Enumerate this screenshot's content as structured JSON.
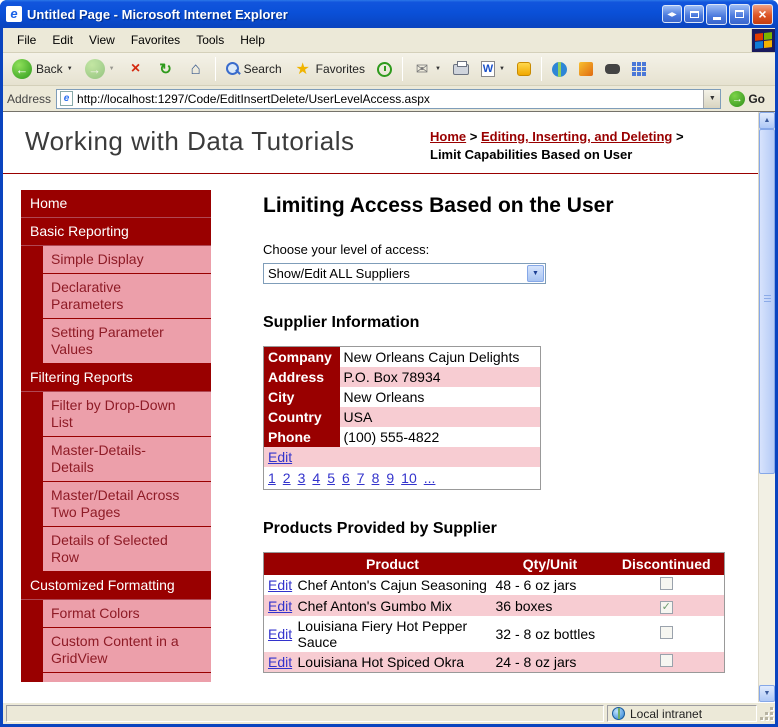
{
  "window": {
    "title": "Untitled Page - Microsoft Internet Explorer"
  },
  "menu": {
    "items": [
      "File",
      "Edit",
      "View",
      "Favorites",
      "Tools",
      "Help"
    ]
  },
  "toolbar": {
    "back": "Back",
    "search": "Search",
    "favorites": "Favorites"
  },
  "address": {
    "label": "Address",
    "url": "http://localhost:1297/Code/EditInsertDelete/UserLevelAccess.aspx",
    "go": "Go"
  },
  "banner": {
    "title": "Working with Data Tutorials",
    "breadcrumb": {
      "home": "Home",
      "sep": ">",
      "section": "Editing, Inserting, and Deleting",
      "current": "Limit Capabilities Based on User"
    }
  },
  "sidebar": {
    "items": [
      {
        "label": "Home",
        "type": "top"
      },
      {
        "label": "Basic Reporting",
        "type": "top"
      },
      {
        "label": "Simple Display",
        "type": "sub"
      },
      {
        "label": "Declarative Parameters",
        "type": "sub"
      },
      {
        "label": "Setting Parameter Values",
        "type": "sub"
      },
      {
        "label": "Filtering Reports",
        "type": "top"
      },
      {
        "label": "Filter by Drop-Down List",
        "type": "sub"
      },
      {
        "label": "Master-Details-Details",
        "type": "sub"
      },
      {
        "label": "Master/Detail Across Two Pages",
        "type": "sub"
      },
      {
        "label": "Details of Selected Row",
        "type": "sub"
      },
      {
        "label": "Customized Formatting",
        "type": "top"
      },
      {
        "label": "Format Colors",
        "type": "sub"
      },
      {
        "label": "Custom Content in a GridView",
        "type": "sub"
      }
    ]
  },
  "content": {
    "page_title": "Limiting Access Based on the User",
    "access_label": "Choose your level of access:",
    "access_selected": "Show/Edit ALL Suppliers",
    "supplier_heading": "Supplier Information",
    "supplier": {
      "fields": [
        {
          "label": "Company",
          "value": "New Orleans Cajun Delights"
        },
        {
          "label": "Address",
          "value": "P.O. Box 78934"
        },
        {
          "label": "City",
          "value": "New Orleans"
        },
        {
          "label": "Country",
          "value": "USA"
        },
        {
          "label": "Phone",
          "value": "(100) 555-4822"
        }
      ],
      "edit": "Edit",
      "pager": [
        "1",
        "2",
        "3",
        "4",
        "5",
        "6",
        "7",
        "8",
        "9",
        "10",
        "..."
      ]
    },
    "products_heading": "Products Provided by Supplier",
    "products": {
      "headers": {
        "product": "Product",
        "qty": "Qty/Unit",
        "discontinued": "Discontinued"
      },
      "edit": "Edit",
      "rows": [
        {
          "product": "Chef Anton's Cajun Seasoning",
          "qty": "48 - 6 oz jars",
          "discontinued": false
        },
        {
          "product": "Chef Anton's Gumbo Mix",
          "qty": "36 boxes",
          "discontinued": true
        },
        {
          "product": "Louisiana Fiery Hot Pepper Sauce",
          "qty": "32 - 8 oz bottles",
          "discontinued": false
        },
        {
          "product": "Louisiana Hot Spiced Okra",
          "qty": "24 - 8 oz jars",
          "discontinued": false
        }
      ]
    }
  },
  "status": {
    "zone": "Local intranet"
  },
  "icons": {
    "ie_logo": "e",
    "back": "←",
    "forward": "→",
    "stop": "×",
    "refresh": "↻",
    "home": "⌂",
    "favorites_star": "★",
    "mail": "✉",
    "dropdown": "▼",
    "go": "→",
    "select_arrow": "▼",
    "scroll_up": "▲",
    "scroll_down": "▼",
    "close": "×",
    "word": "W",
    "pan": "◀▶",
    "check": "✓"
  },
  "colors": {
    "maroon": "#990000",
    "pink_nav": "#ec9faa",
    "pink_row": "#f7ccd2",
    "link_blue": "#3333cc",
    "titlebar_blue": "#0a50d8"
  }
}
